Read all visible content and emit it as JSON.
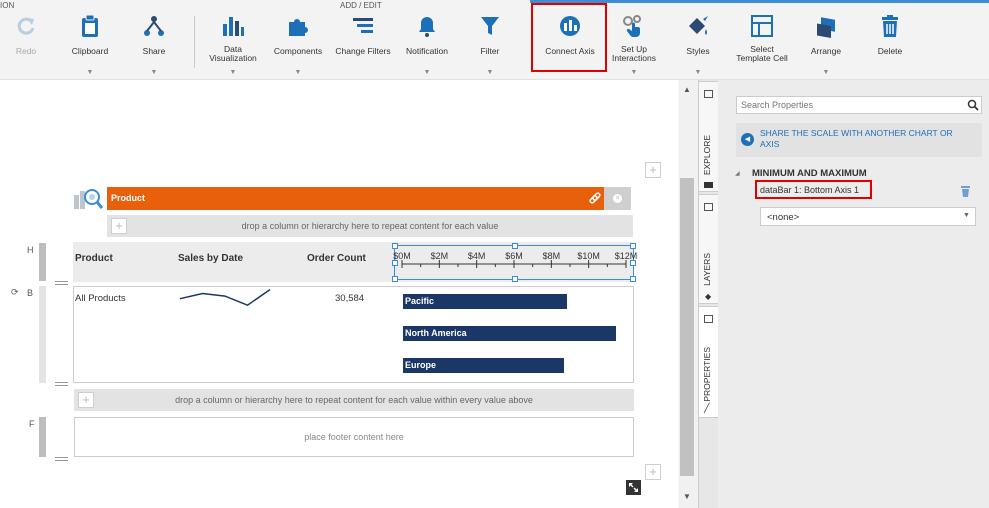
{
  "ribbon": {
    "groups": {
      "left_partial": "ION",
      "add_edit": "ADD / EDIT"
    },
    "buttons": {
      "redo": "Redo",
      "clipboard": "Clipboard",
      "share": "Share",
      "data_visualization": [
        "Data",
        "Visualization"
      ],
      "components": "Components",
      "change_filters": "Change Filters",
      "notification": "Notification",
      "filter": "Filter",
      "connect_axis": "Connect Axis",
      "set_up_interactions": [
        "Set Up",
        "Interactions"
      ],
      "styles": "Styles",
      "select_template_cell": [
        "Select",
        "Template Cell"
      ],
      "arrange": "Arrange",
      "delete": "Delete"
    }
  },
  "canvas": {
    "product_bar_label": "Product",
    "repeat_zone_top": "drop a column or hierarchy here to repeat content for each value",
    "section_labels": {
      "header": "H",
      "body": "B",
      "footer": "F"
    },
    "columns": {
      "product": "Product",
      "sales_by_date": "Sales by Date",
      "order_count": "Order Count"
    },
    "axis_ticks": [
      "$0M",
      "$2M",
      "$4M",
      "$6M",
      "$8M",
      "$10M",
      "$12M"
    ],
    "row": {
      "product": "All Products",
      "order_count": "30,584"
    },
    "sparkline": [
      0.55,
      0.75,
      0.65,
      0.3,
      0.9
    ],
    "bars": [
      {
        "label": "Pacific",
        "value": 8.8
      },
      {
        "label": "North America",
        "value": 11.4
      },
      {
        "label": "Europe",
        "value": 8.6
      }
    ],
    "axis_max": 12,
    "repeat_zone_bottom": "drop a column or hierarchy here to repeat content for each value within every value above",
    "footer_placeholder": "place footer content here"
  },
  "side_tabs": {
    "explore": "EXPLORE",
    "layers": "LAYERS",
    "properties": "PROPERTIES"
  },
  "properties": {
    "search_placeholder": "Search Properties",
    "info_line1": "SHARE THE SCALE WITH ANOTHER CHART OR",
    "info_line2": "AXIS",
    "section_title": "MINIMUM AND MAXIMUM",
    "axis_item": "dataBar 1: Bottom Axis 1",
    "select_value": "<none>"
  },
  "colors": {
    "accent": "#e8600c",
    "bar": "#1a3766",
    "link": "#1d6fb8",
    "highlight": "#e00000",
    "progress": "#3c8dd4"
  }
}
